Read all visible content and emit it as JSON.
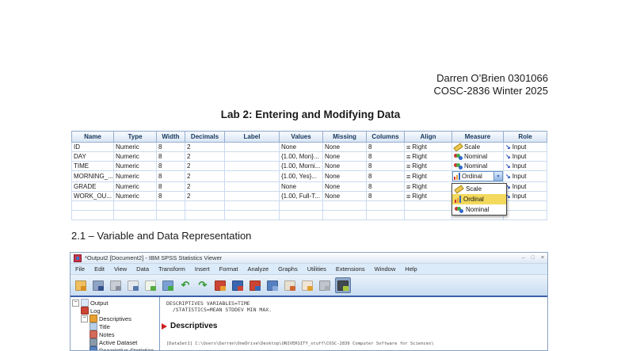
{
  "header": {
    "line1": "Darren O’Brien 0301066",
    "line2": "COSC-2836 Winter 2025",
    "title": "Lab 2: Entering and Modifying Data"
  },
  "section": {
    "heading": "2.1 – Variable and Data Representation"
  },
  "variable_view": {
    "columns": [
      "Name",
      "Type",
      "Width",
      "Decimals",
      "Label",
      "Values",
      "Missing",
      "Columns",
      "Align",
      "Measure",
      "Role"
    ],
    "rows": [
      {
        "name": "ID",
        "type": "Numeric",
        "width": "8",
        "decimals": "2",
        "label": "",
        "values": "None",
        "missing": "None",
        "columns": "8",
        "align": "Right",
        "measure": "Scale",
        "measure_icon": "scale",
        "role": "Input",
        "combo": false
      },
      {
        "name": "DAY",
        "type": "Numeric",
        "width": "8",
        "decimals": "2",
        "label": "",
        "values": "{1.00, Mon}...",
        "missing": "None",
        "columns": "8",
        "align": "Right",
        "measure": "Nominal",
        "measure_icon": "nominal",
        "role": "Input",
        "combo": false
      },
      {
        "name": "TIME",
        "type": "Numeric",
        "width": "8",
        "decimals": "2",
        "label": "",
        "values": "{1.00, Morni...",
        "missing": "None",
        "columns": "8",
        "align": "Right",
        "measure": "Nominal",
        "measure_icon": "nominal",
        "role": "Input",
        "combo": false
      },
      {
        "name": "MORNING_...",
        "type": "Numeric",
        "width": "8",
        "decimals": "2",
        "label": "",
        "values": "{1.00, Yes}...",
        "missing": "None",
        "columns": "8",
        "align": "Right",
        "measure": "Ordinal",
        "measure_icon": "ordinal",
        "role": "Input",
        "combo": true
      },
      {
        "name": "GRADE",
        "type": "Numeric",
        "width": "8",
        "decimals": "2",
        "label": "",
        "values": "None",
        "missing": "None",
        "columns": "8",
        "align": "Right",
        "measure": "",
        "measure_icon": "",
        "role": "Input",
        "combo": false
      },
      {
        "name": "WORK_OU...",
        "type": "Numeric",
        "width": "8",
        "decimals": "2",
        "label": "",
        "values": "{1.00, Full-T...",
        "missing": "None",
        "columns": "8",
        "align": "Right",
        "measure": "",
        "measure_icon": "",
        "role": "Input",
        "combo": false
      }
    ],
    "empty_rows": 2,
    "measure_dropdown": {
      "selected": "Ordinal",
      "options": [
        {
          "label": "Scale",
          "icon": "scale",
          "highlighted": false
        },
        {
          "label": "Ordinal",
          "icon": "ordinal",
          "highlighted": true
        },
        {
          "label": "Nominal",
          "icon": "nominal",
          "highlighted": false
        }
      ]
    },
    "dropdown_arrow": "▼"
  },
  "viewer": {
    "window_title": "*Output2 [Document2] - IBM SPSS Statistics Viewer",
    "controls": {
      "minimize": "–",
      "maximize": "□",
      "close": "×"
    },
    "menus": [
      "File",
      "Edit",
      "View",
      "Data",
      "Transform",
      "Insert",
      "Format",
      "Analyze",
      "Graphs",
      "Utilities",
      "Extensions",
      "Window",
      "Help"
    ],
    "toolbar_icons": [
      {
        "name": "open",
        "c1": "#f0c060",
        "c2": "#d89020",
        "char": "",
        "pressed": false
      },
      {
        "name": "save",
        "c1": "#8fa3c6",
        "c2": "#33508a",
        "char": "",
        "pressed": false
      },
      {
        "name": "print",
        "c1": "#c8ccd4",
        "c2": "#8890a0",
        "char": "",
        "pressed": false
      },
      {
        "name": "print-preview",
        "c1": "#e4e8ee",
        "c2": "#5577aa",
        "char": "",
        "pressed": false
      },
      {
        "name": "export",
        "c1": "#eef4ea",
        "c2": "#55aa44",
        "char": "",
        "pressed": false
      },
      {
        "name": "recall-dialogs",
        "c1": "#7aa0d4",
        "c2": "#44aa44",
        "char": "",
        "pressed": false
      },
      {
        "name": "undo",
        "c1": "",
        "c2": "",
        "char": "↶",
        "pressed": false
      },
      {
        "name": "redo",
        "c1": "",
        "c2": "",
        "char": "↷",
        "pressed": false
      },
      {
        "name": "goto-case",
        "c1": "#cc4433",
        "c2": "#e8a030",
        "char": "",
        "pressed": false
      },
      {
        "name": "goto-variable",
        "c1": "#3a66b0",
        "c2": "#cc4433",
        "char": "",
        "pressed": false
      },
      {
        "name": "variables",
        "c1": "#cc4433",
        "c2": "#3a66b0",
        "char": "",
        "pressed": false
      },
      {
        "name": "value-labels",
        "c1": "#5580c0",
        "c2": "#88aadd",
        "char": "",
        "pressed": false
      },
      {
        "name": "use-sets",
        "c1": "#e8e0d0",
        "c2": "#cc6633",
        "char": "",
        "pressed": false
      },
      {
        "name": "highlight",
        "c1": "#f0e4d4",
        "c2": "#e0a030",
        "char": "",
        "pressed": false
      },
      {
        "name": "disabled",
        "c1": "#c0c4cc",
        "c2": "#a8acb4",
        "char": "",
        "pressed": false
      },
      {
        "name": "show-hide",
        "c1": "#404850",
        "c2": "#a8c838",
        "char": "",
        "pressed": true
      }
    ],
    "outline": [
      {
        "label": "Output",
        "depth": 0,
        "icon": "output",
        "expander": true
      },
      {
        "label": "Log",
        "depth": 1,
        "icon": "log",
        "expander": false
      },
      {
        "label": "Descriptives",
        "depth": 1,
        "icon": "descriptives",
        "expander": true
      },
      {
        "label": "Title",
        "depth": 2,
        "icon": "title",
        "expander": false
      },
      {
        "label": "Notes",
        "depth": 2,
        "icon": "notes",
        "expander": false
      },
      {
        "label": "Active Dataset",
        "depth": 2,
        "icon": "active-dataset",
        "expander": false
      },
      {
        "label": "Descriptive Statistics",
        "depth": 2,
        "icon": "descriptive-statistics",
        "expander": false
      }
    ],
    "content": {
      "syntax_line1": "DESCRIPTIVES VARIABLES=TIME",
      "syntax_line2": "  /STATISTICS=MEAN STDDEV MIN MAX.",
      "heading": "Descriptives",
      "dataset_line": "[DataSet1] C:\\Users\\Darren\\OneDrive\\Desktop\\UNIVERSITY_stuff\\COSC-2836 Computer Software for Sciences\\"
    }
  }
}
